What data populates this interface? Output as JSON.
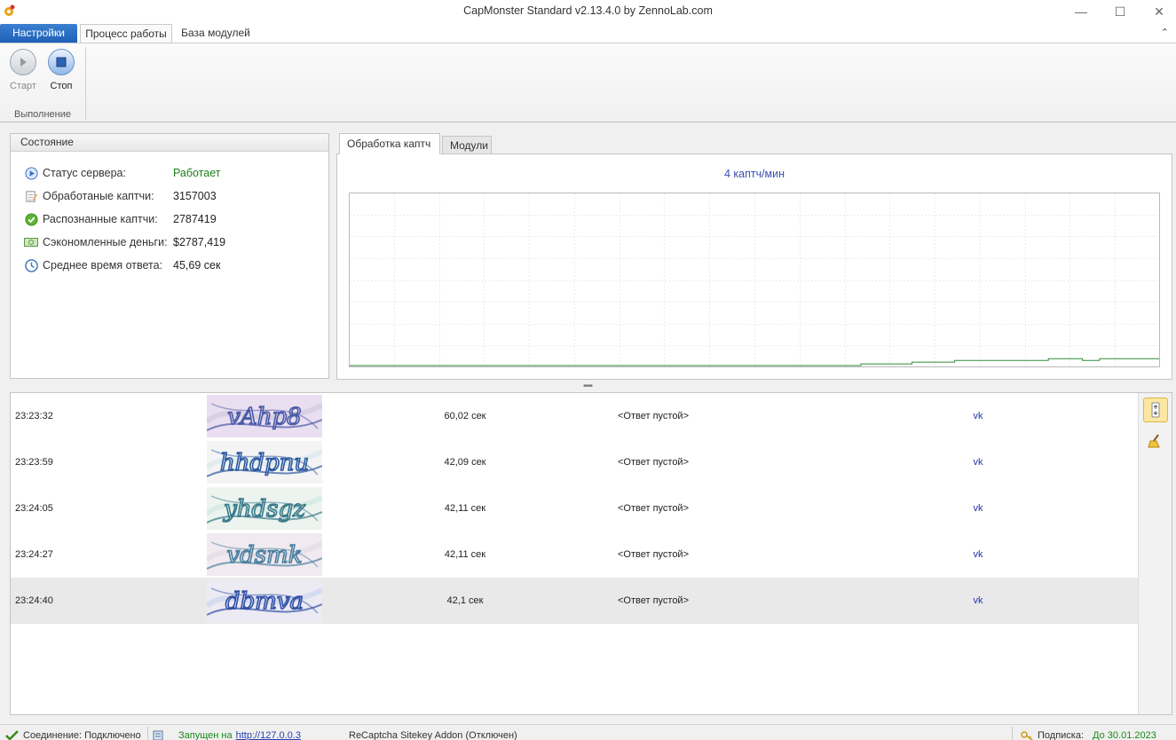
{
  "window": {
    "title": "CapMonster Standard v2.13.4.0 by ZennoLab.com",
    "minimize": "—",
    "maximize": "☐",
    "close": "✕"
  },
  "ribbon": {
    "tabs": [
      "Настройки",
      "Процесс работы",
      "База модулей"
    ],
    "start_label": "Старт",
    "stop_label": "Стоп",
    "group_label": "Выполнение",
    "collapse": "⌃"
  },
  "status": {
    "title": "Состояние",
    "rows": [
      {
        "label": "Статус сервера:",
        "value": "Работает",
        "icon": "play-circle-icon"
      },
      {
        "label": "Обработаные каптчи:",
        "value": "3157003",
        "icon": "edit-document-icon"
      },
      {
        "label": "Распознанные каптчи:",
        "value": "2787419",
        "icon": "check-circle-icon"
      },
      {
        "label": "Сэкономленные деньги:",
        "value": "$2787,419",
        "icon": "money-icon"
      },
      {
        "label": "Среднее время ответа:",
        "value": "45,69 сек",
        "icon": "clock-icon"
      }
    ]
  },
  "chart_tabs": [
    "Обработка каптч",
    "Модули"
  ],
  "chart_data": {
    "type": "line",
    "title": "4 каптч/мин",
    "series": [
      {
        "values": [
          0,
          0,
          0,
          0,
          0,
          0,
          0,
          0,
          0,
          0,
          0,
          0,
          0,
          0,
          0,
          0,
          0,
          0,
          0,
          0,
          0,
          0,
          0,
          0,
          0,
          0,
          0,
          0,
          0,
          0,
          0,
          0,
          0,
          0,
          0,
          0,
          0,
          0,
          0,
          0,
          0,
          0,
          0,
          0,
          0,
          0,
          0,
          0,
          0,
          0,
          0,
          0,
          0,
          0,
          0,
          0,
          0,
          0,
          0,
          0,
          1,
          1,
          1,
          1,
          1,
          1,
          2,
          2,
          2,
          2,
          2,
          3,
          3,
          3,
          3,
          3,
          3,
          3,
          3,
          3,
          3,
          3,
          4,
          4,
          4,
          4,
          3,
          3,
          4,
          4,
          4,
          4,
          4,
          4,
          4,
          4
        ]
      }
    ],
    "ylim": [
      0,
      100
    ],
    "grid": true
  },
  "log": {
    "rows": [
      {
        "time": "23:23:32",
        "duration": "60,02 сек",
        "answer": "<Ответ пустой>",
        "module": "vk",
        "captcha": "vAhp8"
      },
      {
        "time": "23:23:59",
        "duration": "42,09 сек",
        "answer": "<Ответ пустой>",
        "module": "vk",
        "captcha": "hhdpnu"
      },
      {
        "time": "23:24:05",
        "duration": "42,11 сек",
        "answer": "<Ответ пустой>",
        "module": "vk",
        "captcha": "yhdsgz"
      },
      {
        "time": "23:24:27",
        "duration": "42,11 сек",
        "answer": "<Ответ пустой>",
        "module": "vk",
        "captcha": "vdsmk"
      },
      {
        "time": "23:24:40",
        "duration": "42,1 сек",
        "answer": "<Ответ пустой>",
        "module": "vk",
        "captcha": "dbmva"
      }
    ]
  },
  "statusbar": {
    "connection": "Соединение: Подключено",
    "running_prefix": "Запущен на",
    "running_link": "http://127.0.0.3",
    "addon": "ReCaptcha Sitekey Addon (Отключен)",
    "subscription_label": "Подписка:",
    "subscription_value": "До 30.01.2023"
  }
}
